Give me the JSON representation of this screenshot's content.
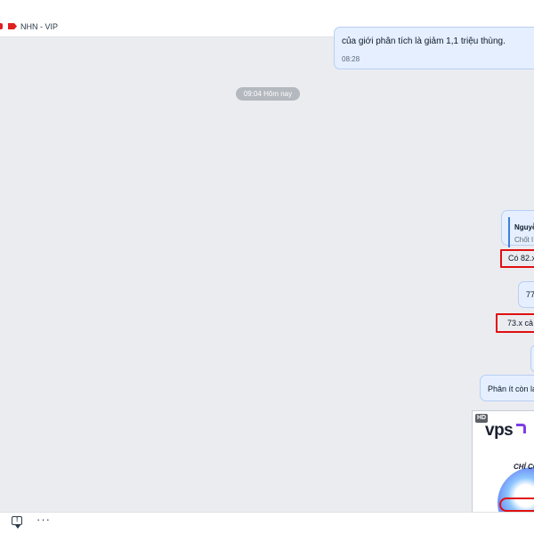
{
  "header": {
    "tag_label": "NHN - VIP",
    "tag_color": "#e02020",
    "tag_icon": "tag-icon"
  },
  "messages": {
    "top": {
      "text": "của giới phân tích là giảm 1,1 triệu thùng.",
      "time": "08:28"
    },
    "date_separator": "09:04 Hôm nay",
    "quote": {
      "name": "Nguyễ",
      "text": "Chốt l"
    },
    "red1_text": "Có 82.x",
    "small1_text": "77",
    "red2_text": "73.x cả",
    "last_text": "Phân ít còn lại"
  },
  "image_card": {
    "badge": "HD",
    "logo": "vps",
    "caption": "CHỈ CÔ"
  },
  "footer": {
    "reply_icon": "message-alert-icon",
    "more_icon": "more-horizontal-icon",
    "more_glyph": "···"
  },
  "colors": {
    "bubble_bg": "#e5efff",
    "bubble_border": "#b7cff3",
    "highlight_red": "#e01010",
    "chat_bg": "#ebecf0"
  }
}
